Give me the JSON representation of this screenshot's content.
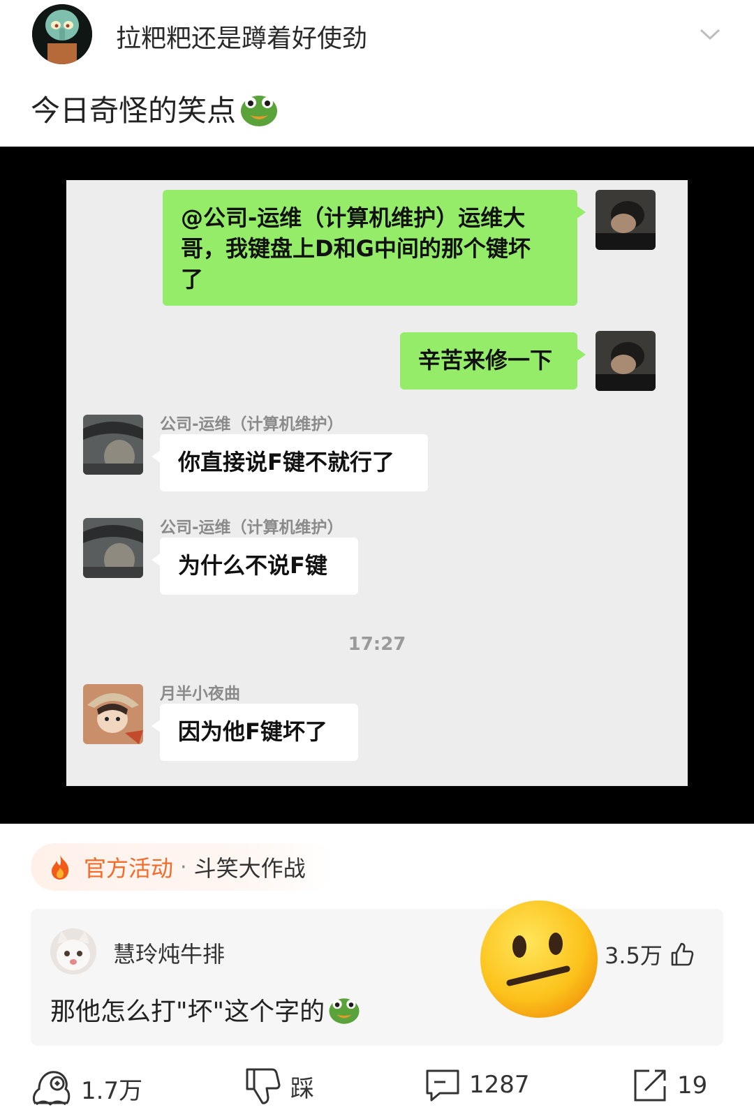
{
  "header": {
    "username": "拉粑粑还是蹲着好使劲",
    "avatar_icon": "squidward-avatar",
    "menu_icon": "chevron-down-icon"
  },
  "post": {
    "text": "今日奇怪的笑点",
    "emoji": "green-frog-emoji"
  },
  "chat": {
    "messages": [
      {
        "side": "right",
        "text": "@公司-运维（计算机维护）运维大哥，我键盘上D和G中间的那个键坏了"
      },
      {
        "side": "right",
        "text": "辛苦来修一下"
      },
      {
        "side": "left",
        "sender": "公司-运维（计算机维护）",
        "text": "你直接说F键不就行了"
      },
      {
        "side": "left",
        "sender": "公司-运维（计算机维护）",
        "text": "为什么不说F键"
      },
      {
        "side": "left",
        "sender": "月半小夜曲",
        "text": "因为他F键坏了"
      }
    ],
    "msg1_line1": "@公司-运维（计算机维护）运维大",
    "msg1_line2": "哥，我键盘上D和G中间的那个键坏",
    "msg1_line3": "了",
    "timestamp": "17:27"
  },
  "activity": {
    "label": "官方活动",
    "separator": "·",
    "name": "斗笑大作战",
    "icon": "flame-icon"
  },
  "comment": {
    "author": "慧玲炖牛排",
    "text": "那他怎么打\"坏\"这个字的",
    "likes": "3.5万",
    "reaction_emoji": "neutral-face-emoji"
  },
  "actions": {
    "repost_count": "1.7万",
    "dislike_label": "踩",
    "comment_count": "1287",
    "share_count": "19"
  },
  "colors": {
    "bubble_green": "#95ec69",
    "chat_bg": "#ededed",
    "activity_orange": "#f36b2a"
  }
}
